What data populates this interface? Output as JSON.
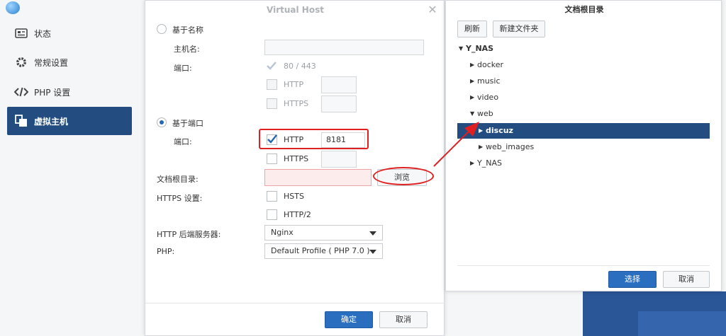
{
  "sidebar": {
    "items": [
      {
        "label": "状态",
        "icon": "status-card-icon"
      },
      {
        "label": "常规设置",
        "icon": "gear-icon"
      },
      {
        "label": "PHP 设置",
        "icon": "code-icon"
      },
      {
        "label": "虚拟主机",
        "icon": "virtual-host-icon"
      }
    ],
    "active_index": 3
  },
  "dialog": {
    "title": "Virtual Host",
    "name_based": {
      "label": "基于名称",
      "hostname_label": "主机名:",
      "port_label": "端口:",
      "port_default": "80 / 443",
      "http": "HTTP",
      "https": "HTTPS"
    },
    "port_based": {
      "label": "基于端口",
      "port_label": "端口:",
      "http": "HTTP",
      "http_port": "8181",
      "https": "HTTPS"
    },
    "docroot_label": "文档根目录:",
    "browse_button": "浏览",
    "https_settings_label": "HTTPS 设置:",
    "hsts": "HSTS",
    "http2": "HTTP/2",
    "backend_label": "HTTP 后端服务器:",
    "backend_value": "Nginx",
    "php_label": "PHP:",
    "php_value": "Default Profile ( PHP 7.0 )",
    "ok_button": "确定",
    "cancel_button": "取消"
  },
  "panel": {
    "title": "文档根目录",
    "refresh_button": "刷新",
    "new_folder_button": "新建文件夹",
    "tree": [
      {
        "label": "Y_NAS",
        "level": 0,
        "expanded": true,
        "bold": true
      },
      {
        "label": "docker",
        "level": 1,
        "expanded": false
      },
      {
        "label": "music",
        "level": 1,
        "expanded": false
      },
      {
        "label": "video",
        "level": 1,
        "expanded": false
      },
      {
        "label": "web",
        "level": 1,
        "expanded": true
      },
      {
        "label": "discuz",
        "level": 2,
        "expanded": false,
        "selected": true
      },
      {
        "label": "web_images",
        "level": 2,
        "expanded": false
      },
      {
        "label": "Y_NAS",
        "level": 1,
        "expanded": false
      }
    ],
    "select_button": "选择",
    "cancel_button": "取消"
  },
  "colors": {
    "accent": "#234d80",
    "primary_button": "#2a6ec0",
    "annotation": "#e02020",
    "error_field": "#fdecec"
  }
}
